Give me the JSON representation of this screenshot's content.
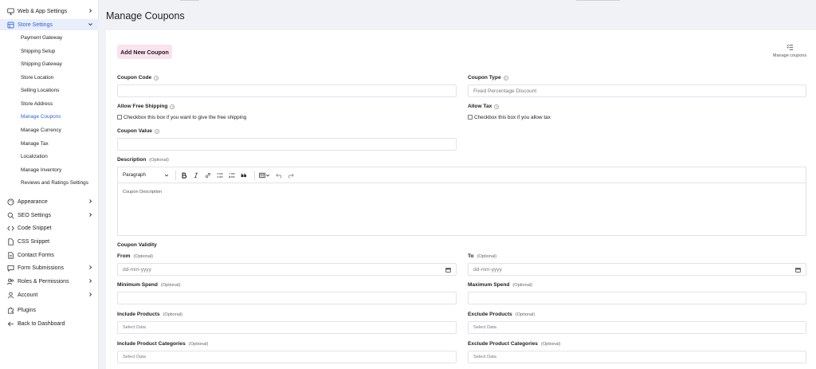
{
  "sidebar": {
    "web_app_settings": "Web & App Settings",
    "store_settings": "Store Settings",
    "sub_items": [
      "Payment Gateway",
      "Shipping Setup",
      "Shipping Gateway",
      "Store Location",
      "Selling Locations",
      "Store Address",
      "Manage Coupons",
      "Manage Currency",
      "Manage Tax",
      "Localization",
      "Manage Inventory",
      "Reviews and Ratings Settings"
    ],
    "appearance": "Appearance",
    "seo_settings": "SEO Settings",
    "code_snippet": "Code Snippet",
    "css_snippet": "CSS Snippet",
    "contact_forms": "Contact Forms",
    "form_submissions": "Form Submissions",
    "roles_permissions": "Roles & Permissions",
    "account": "Account",
    "plugins": "Plugins",
    "back_to_dashboard": "Back to Dashboard",
    "active_color": "#2f62d8"
  },
  "page": {
    "title": "Manage Coupons",
    "add_new_coupon": "Add New Coupon",
    "manage_coupons_link": "Manage coupons"
  },
  "form": {
    "coupon_code_label": "Coupon Code",
    "coupon_type_label": "Coupon Type",
    "coupon_type_value": "Fixed Percentage Discount",
    "allow_free_shipping_label": "Allow Free Shipping",
    "free_shipping_checkbox": "Checkbox this box if you want to give the free shipping",
    "allow_tax_label": "Allow Tax",
    "allow_tax_checkbox": "Checkbox this box if you allow tax",
    "coupon_value_label": "Coupon Value",
    "description_label": "Description",
    "optional": "(Optional)",
    "editor_format": "Paragraph",
    "editor_placeholder": "Coupon Description",
    "coupon_validity": "Coupon Validity",
    "from_label": "From",
    "to_label": "To",
    "date_placeholder": "dd-mm-yyyy",
    "minimum_spend_label": "Minimum Spend",
    "maximum_spend_label": "Maximum Spend",
    "include_products_label": "Include Products",
    "exclude_products_label": "Exclude Products",
    "include_categories_label": "Include Product Categories",
    "exclude_categories_label": "Exclude Product Categories",
    "select_placeholder": "Select Data"
  },
  "colors": {
    "add_button_bg": "#fbe3ee",
    "page_bg": "#f1f2f5"
  }
}
